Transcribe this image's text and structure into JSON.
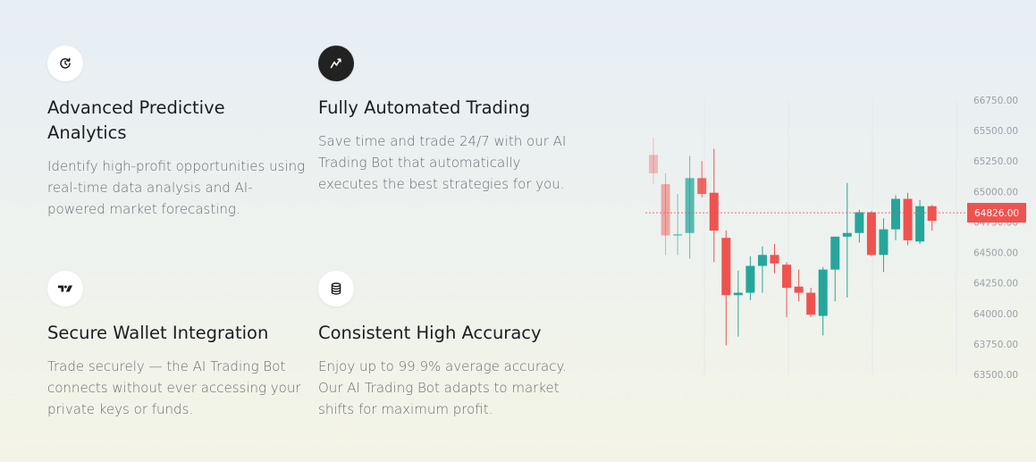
{
  "features": [
    {
      "title": "Advanced Predictive Analytics",
      "description": "Identify high-profit opportunities using real-time data analysis and AI-powered market forecasting.",
      "icon": "refresh-clock-icon"
    },
    {
      "title": "Fully Automated Trading",
      "description": "Save time and trade 24/7 with our AI Trading Bot that automatically executes the best strategies for you.",
      "icon": "trend-line-icon"
    },
    {
      "title": "Secure Wallet Integration",
      "description": "Trade securely — the AI Trading Bot connects without ever accessing your private keys or funds.",
      "icon": "tradingview-logo-icon"
    },
    {
      "title": "Consistent High Accuracy",
      "description": "Enjoy up to 99.9% average accuracy. Our AI Trading Bot adapts to market shifts for maximum profit.",
      "icon": "database-icon"
    }
  ],
  "chart_data": {
    "type": "candlestick",
    "y_ticks": [
      "66750.00",
      "65500.00",
      "65250.00",
      "65000.00",
      "64750.00",
      "64500.00",
      "64250.00",
      "64000.00",
      "63750.00",
      "63500.00"
    ],
    "last_price_label": "64826.00",
    "last_price": 64826,
    "colors": {
      "up": "#26a69a",
      "down": "#ef5350",
      "grid": "#e4e8ea",
      "last_line": "#ef5350"
    },
    "candles": [
      {
        "o": 65300,
        "h": 65440,
        "l": 65060,
        "c": 65150
      },
      {
        "o": 65060,
        "h": 65150,
        "l": 64480,
        "c": 64640
      },
      {
        "o": 64640,
        "h": 64980,
        "l": 64480,
        "c": 64650
      },
      {
        "o": 64660,
        "h": 65290,
        "l": 64450,
        "c": 65110
      },
      {
        "o": 65110,
        "h": 65250,
        "l": 64950,
        "c": 64980
      },
      {
        "o": 64990,
        "h": 65350,
        "l": 64420,
        "c": 64680
      },
      {
        "o": 64620,
        "h": 64680,
        "l": 63740,
        "c": 64150
      },
      {
        "o": 64150,
        "h": 64350,
        "l": 63810,
        "c": 64170
      },
      {
        "o": 64170,
        "h": 64470,
        "l": 64110,
        "c": 64390
      },
      {
        "o": 64390,
        "h": 64550,
        "l": 64170,
        "c": 64480
      },
      {
        "o": 64480,
        "h": 64570,
        "l": 64330,
        "c": 64410
      },
      {
        "o": 64400,
        "h": 64420,
        "l": 63970,
        "c": 64210
      },
      {
        "o": 64220,
        "h": 64360,
        "l": 64100,
        "c": 64170
      },
      {
        "o": 64170,
        "h": 64210,
        "l": 63970,
        "c": 63990
      },
      {
        "o": 63980,
        "h": 64380,
        "l": 63820,
        "c": 64360
      },
      {
        "o": 64360,
        "h": 64620,
        "l": 64100,
        "c": 64630
      },
      {
        "o": 64630,
        "h": 65070,
        "l": 64130,
        "c": 64660
      },
      {
        "o": 64660,
        "h": 64850,
        "l": 64580,
        "c": 64830
      },
      {
        "o": 64830,
        "h": 64840,
        "l": 64470,
        "c": 64480
      },
      {
        "o": 64480,
        "h": 64780,
        "l": 64340,
        "c": 64690
      },
      {
        "o": 64690,
        "h": 64970,
        "l": 64600,
        "c": 64940
      },
      {
        "o": 64940,
        "h": 64990,
        "l": 64560,
        "c": 64600
      },
      {
        "o": 64590,
        "h": 64930,
        "l": 64570,
        "c": 64880
      },
      {
        "o": 64880,
        "h": 64890,
        "l": 64680,
        "c": 64760
      }
    ]
  }
}
